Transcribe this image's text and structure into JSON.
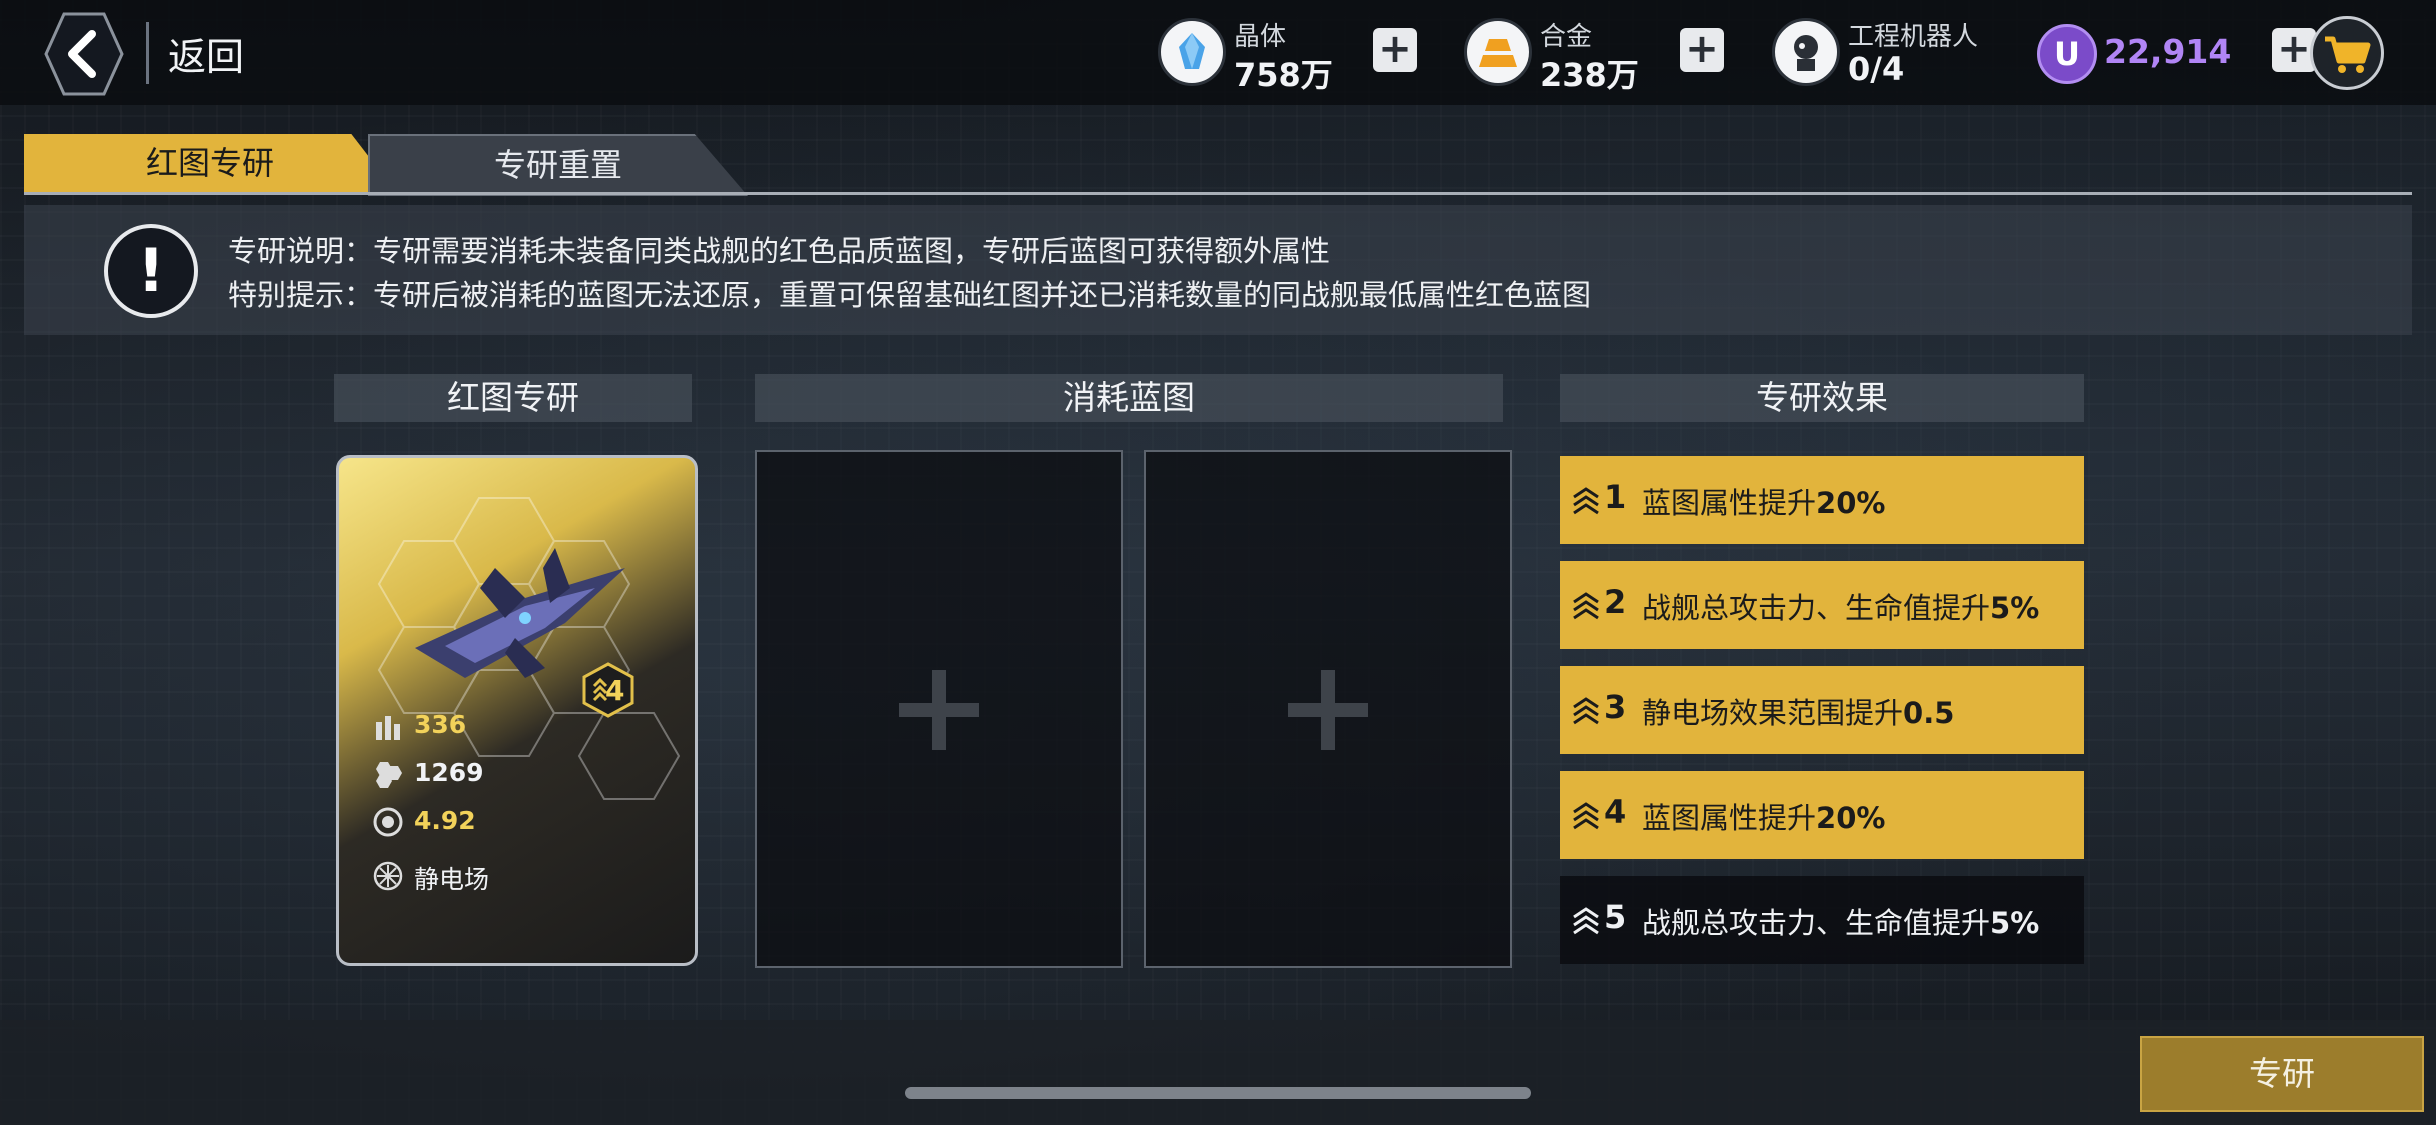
{
  "header": {
    "back_label": "返回",
    "resources": [
      {
        "name": "晶体",
        "value": "758万",
        "icon": "crystal-icon",
        "color": "#4aa3e8"
      },
      {
        "name": "合金",
        "value": "238万",
        "icon": "alloy-icon",
        "color": "#f0a020"
      },
      {
        "name": "工程机器人",
        "value": "0/4",
        "icon": "robot-icon"
      }
    ],
    "premium": {
      "symbol": "U",
      "value": "22,914",
      "color": "#b185f5"
    }
  },
  "tabs": [
    {
      "label": "红图专研",
      "active": true
    },
    {
      "label": "专研重置",
      "active": false
    }
  ],
  "notice": {
    "line1": "专研说明：专研需要消耗未装备同类战舰的红色品质蓝图，专研后蓝图可获得额外属性",
    "line2": "特别提示：专研后被消耗的蓝图无法还原，重置可保留基础红图并还已消耗数量的同战舰最低属性红色蓝图"
  },
  "sections": {
    "blueprint": "红图专研",
    "consume": "消耗蓝图",
    "effects": "专研效果"
  },
  "card": {
    "level": "4",
    "stats": [
      {
        "icon": "ammo-icon",
        "value": "336",
        "color": "#f2d25a"
      },
      {
        "icon": "hp-icon",
        "value": "1269",
        "color": "#f1f3f6"
      },
      {
        "icon": "speed-icon",
        "value": "4.92",
        "color": "#f2d25a"
      },
      {
        "icon": "static-field-icon",
        "value": "静电场",
        "color": "#f1f3f6"
      }
    ]
  },
  "effects": [
    {
      "level": "1",
      "text": "蓝图属性提升",
      "bold": "20%",
      "active": true
    },
    {
      "level": "2",
      "text": "战舰总攻击力、生命值提升",
      "bold": "5%",
      "active": true
    },
    {
      "level": "3",
      "text": "静电场效果范围提升",
      "bold": "0.5",
      "active": true
    },
    {
      "level": "4",
      "text": "蓝图属性提升",
      "bold": "20%",
      "active": true
    },
    {
      "level": "5",
      "text": "战舰总攻击力、生命值提升",
      "bold": "5%",
      "active": false
    }
  ],
  "actions": {
    "research_label": "专研"
  }
}
